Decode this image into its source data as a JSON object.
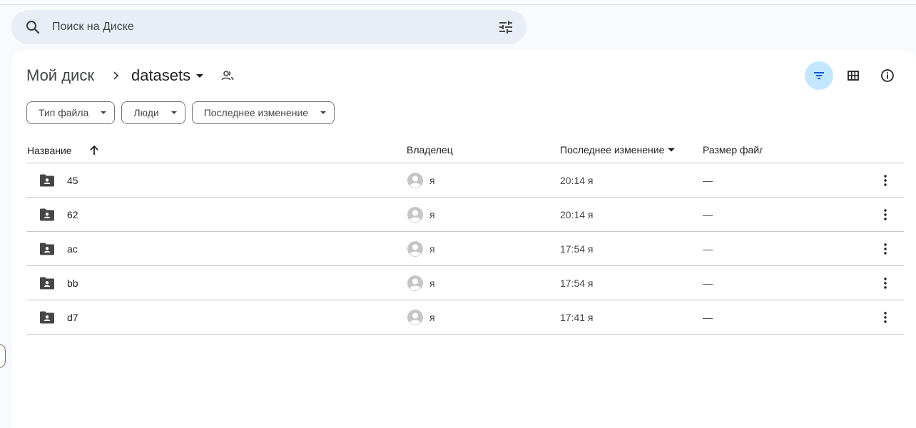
{
  "search": {
    "placeholder": "Поиск на Диске"
  },
  "breadcrumb": {
    "root": "Мой диск",
    "current": "datasets"
  },
  "filters": [
    {
      "label": "Тип файла"
    },
    {
      "label": "Люди"
    },
    {
      "label": "Последнее изменение"
    }
  ],
  "table": {
    "headers": {
      "name": "Название",
      "owner": "Владелец",
      "modified": "Последнее изменение",
      "size": "Размер файла"
    },
    "rows": [
      {
        "name": "45",
        "owner": "я",
        "modified": "20:14 я",
        "size": "—"
      },
      {
        "name": "62",
        "owner": "я",
        "modified": "20:14 я",
        "size": "—"
      },
      {
        "name": "ac",
        "owner": "я",
        "modified": "17:54 я",
        "size": "—"
      },
      {
        "name": "bb",
        "owner": "я",
        "modified": "17:54 я",
        "size": "—"
      },
      {
        "name": "d7",
        "owner": "я",
        "modified": "17:41 я",
        "size": "—"
      }
    ]
  },
  "colors": {
    "search_bg": "#e9eef6",
    "active_btn_bg": "#c2e7ff",
    "folder_icon": "#444746",
    "avatar": "#c4c7c5"
  },
  "icons": {
    "search": "search-icon",
    "tune": "tune-icon",
    "breadcrumb_separator": "chevron-right-icon",
    "folder_caret": "caret-down-icon",
    "shared": "people-icon",
    "filter_view": "filter-icon",
    "grid_view": "grid-icon",
    "info": "info-icon",
    "sort_up": "arrow-up-icon",
    "sort_down": "caret-down-icon",
    "shared_folder": "shared-folder-icon",
    "avatar": "avatar-icon",
    "more": "more-vert-icon"
  }
}
